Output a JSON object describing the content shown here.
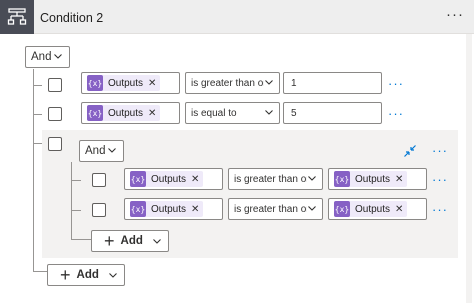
{
  "header": {
    "title": "Condition 2",
    "more_label": "···",
    "icon": "condition-icon"
  },
  "root": {
    "operator": "And",
    "rows": [
      {
        "token": "Outputs",
        "token_icon": "{x}",
        "operator": "is greater than or...",
        "value": "1"
      },
      {
        "token": "Outputs",
        "token_icon": "{x}",
        "operator": "is equal to",
        "value": "5"
      }
    ],
    "add_label": "Add"
  },
  "group": {
    "operator": "And",
    "rows": [
      {
        "token": "Outputs",
        "token_icon": "{x}",
        "operator": "is greater than or...",
        "value_token": "Outputs"
      },
      {
        "token": "Outputs",
        "token_icon": "{x}",
        "operator": "is greater than or...",
        "value_token": "Outputs"
      }
    ],
    "add_label": "Add"
  },
  "labels": {
    "more": "···",
    "token_close": "✕"
  },
  "colors": {
    "header_bg": "#eeeeee",
    "icon_bg": "#494c56",
    "token_bg": "#efeaf9",
    "token_icon_bg": "#8661c5",
    "accent": "#0078d4",
    "group_bg": "#f3f2f1"
  }
}
